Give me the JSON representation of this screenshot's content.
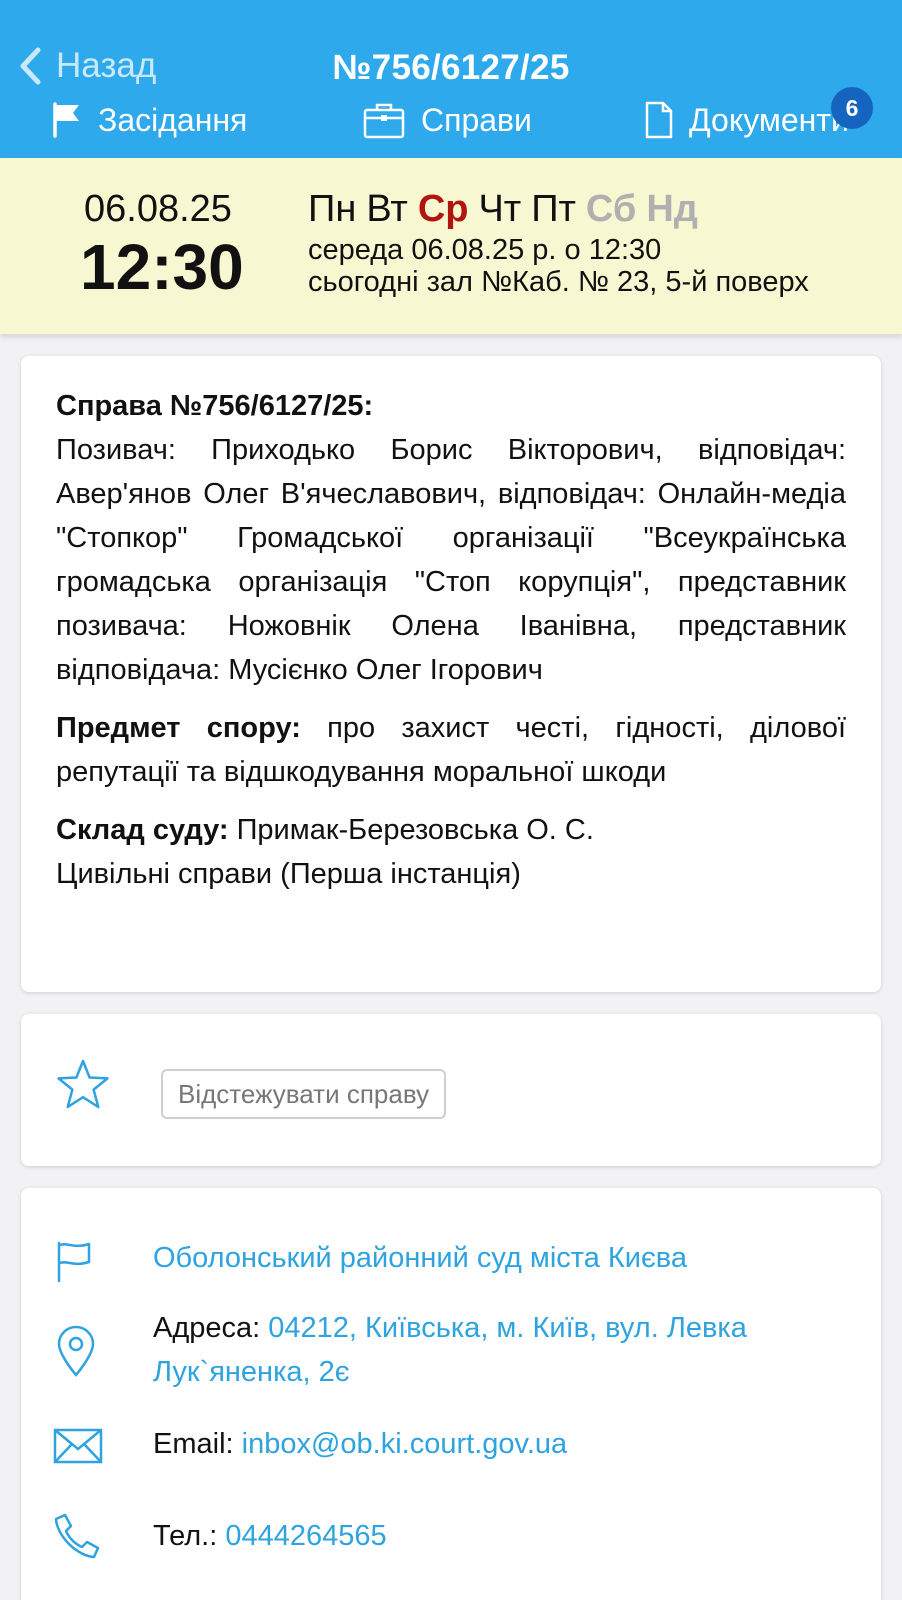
{
  "header": {
    "back_label": "Назад",
    "title": "№756/6127/25",
    "tabs": [
      {
        "label": "Засідання",
        "icon": "flag-icon"
      },
      {
        "label": "Справи",
        "icon": "briefcase-icon"
      },
      {
        "label": "Документи",
        "icon": "document-icon"
      }
    ],
    "documents_badge": "6",
    "colors": {
      "bar": "#2ea9ec",
      "badge": "#1565c0"
    }
  },
  "session": {
    "date": "06.08.25",
    "time": "12:30",
    "weekdays": [
      "Пн",
      "Вт",
      "Ср",
      "Чт",
      "Пт",
      "Сб",
      "Нд"
    ],
    "current_weekday": "Ср",
    "line1": "середа 06.08.25 р. о 12:30",
    "line2": "сьогодні зал №Каб. № 23, 5-й поверх",
    "colors": {
      "band": "#f7f7d2",
      "current_day": "#b1150f",
      "weekend": "#b0b0b0"
    }
  },
  "case": {
    "heading": "Справа №756/6127/25:",
    "parties": "Позивач: Приходько Борис Вікторович, відповідач: Авер'янов Олег В'ячеславович, відповідач: Онлайн-медіа \"Стопкор\" Громадської організації \"Всеукраїнська громадська організація \"Стоп корупція\", представник позивача: Ножовнік Олена Іванівна, представник відповідача: Мусієнко Олег Ігорович",
    "subject_label": "Предмет спору:",
    "subject": " про захист честі, гідності, ділової репутації та відшкодування моральної шкоди",
    "court_label": "Склад суду:",
    "court": " Примак-Березовська О. С.",
    "category": "Цивільні справи (Перша інстанція)"
  },
  "follow": {
    "icon": "star-icon",
    "button_label": "Відстежувати справу"
  },
  "court_info": {
    "name": "Оболонський районний суд міста Києва",
    "address_label": "Адреса: ",
    "address": "04212, Київська, м. Київ, вул. Левка Лук`яненка, 2є",
    "email_label": "Email: ",
    "email": "inbox@ob.ki.court.gov.ua",
    "phone_label": "Тел.: ",
    "phone": "0444264565",
    "link_color": "#2ea3df"
  }
}
